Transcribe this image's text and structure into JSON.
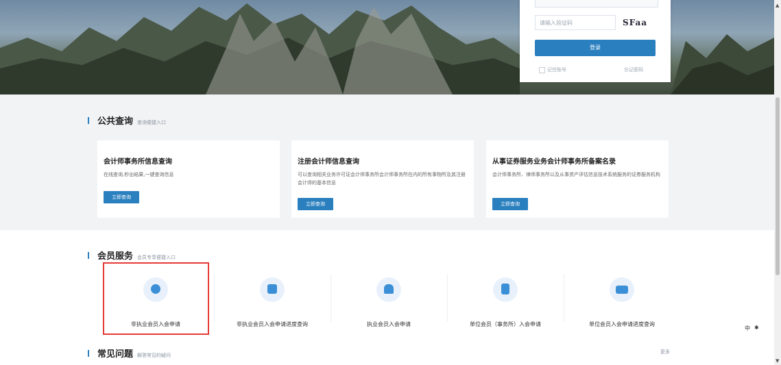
{
  "login": {
    "captcha_placeholder": "请输入验证码",
    "captcha_text": "SFaa",
    "login_button": "登录",
    "remember_label": "记住账号",
    "forgot_label": "忘记密码"
  },
  "public_query": {
    "title": "公共查询",
    "subtitle": "查询便捷入口",
    "cards": [
      {
        "title": "会计师事务所信息查询",
        "desc": "在线查询,秒出结果,一键查询信息",
        "button": "立即查询"
      },
      {
        "title": "注册会计师信息查询",
        "desc": "可以查询相关业务许可证会计师事务所会计师事务所在内的所有事物所及其注册会计师的基本信息",
        "button": "立即查询"
      },
      {
        "title": "从事证券服务业务会计师事务所备案名录",
        "desc": "会计师事务所、律师事务所以及从事资产评估信息技术系统服务的证券服务机构",
        "button": "立即查询"
      }
    ]
  },
  "member_service": {
    "title": "会员服务",
    "subtitle": "会员专享便捷入口",
    "items": [
      {
        "label": "非执业会员入会申请",
        "icon": "user-icon"
      },
      {
        "label": "非执业会员入会申请进度查询",
        "icon": "monitor-icon"
      },
      {
        "label": "执业会员入会申请",
        "icon": "person-tie-icon"
      },
      {
        "label": "单位会员（事务所）入会申请",
        "icon": "document-icon"
      },
      {
        "label": "单位会员入会申请进度查询",
        "icon": "id-card-icon"
      }
    ]
  },
  "faq": {
    "title": "常见问题",
    "subtitle": "解答常见的疑问",
    "more": "更多"
  },
  "tray": {
    "lang": "中",
    "icon2": "✱"
  },
  "colors": {
    "accent": "#2a7fbf",
    "highlight": "#e53935"
  }
}
